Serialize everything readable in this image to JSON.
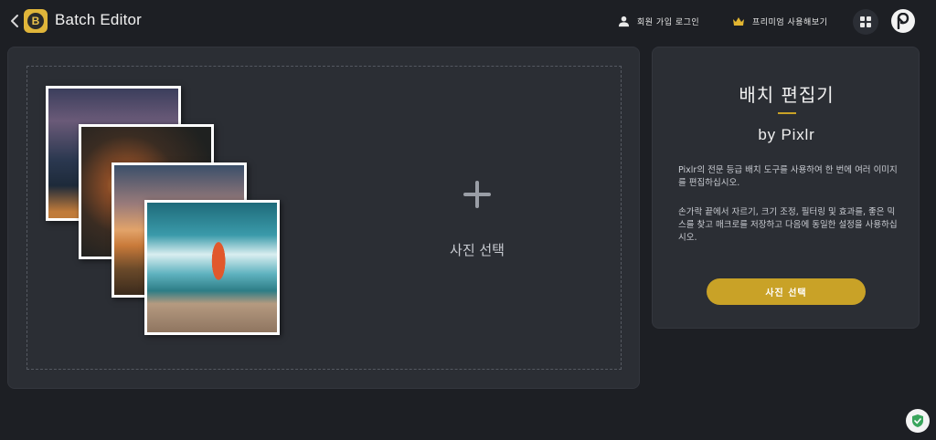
{
  "header": {
    "app_title": "Batch Editor",
    "logo_letter": "B",
    "login_label": "회원 가입 로그인",
    "premium_label": "프리미엄 사용해보기"
  },
  "dropzone": {
    "label": "사진 선택"
  },
  "info": {
    "title": "배치 편집기",
    "byline": "by Pixlr",
    "paragraph1": "Pixlr의 전문 등급 배치 도구를 사용하여 한 번에 여러 이미지를 편집하십시오.",
    "paragraph2": "손가락 끝에서 자르기, 크기 조정, 필터링 및 효과를, 좋은 믹스를 찾고 매크로를 저장하고 다음에 동일한 설정을 사용하십시오.",
    "button_label": "사진 선택"
  },
  "colors": {
    "background": "#1d1f24",
    "panel": "#2b2e34",
    "accent": "#c9a227"
  },
  "icons": [
    "chevron-left-icon",
    "app-logo",
    "user-icon",
    "crown-icon",
    "grid-icon",
    "pixlr-logo-icon",
    "shield-icon"
  ]
}
